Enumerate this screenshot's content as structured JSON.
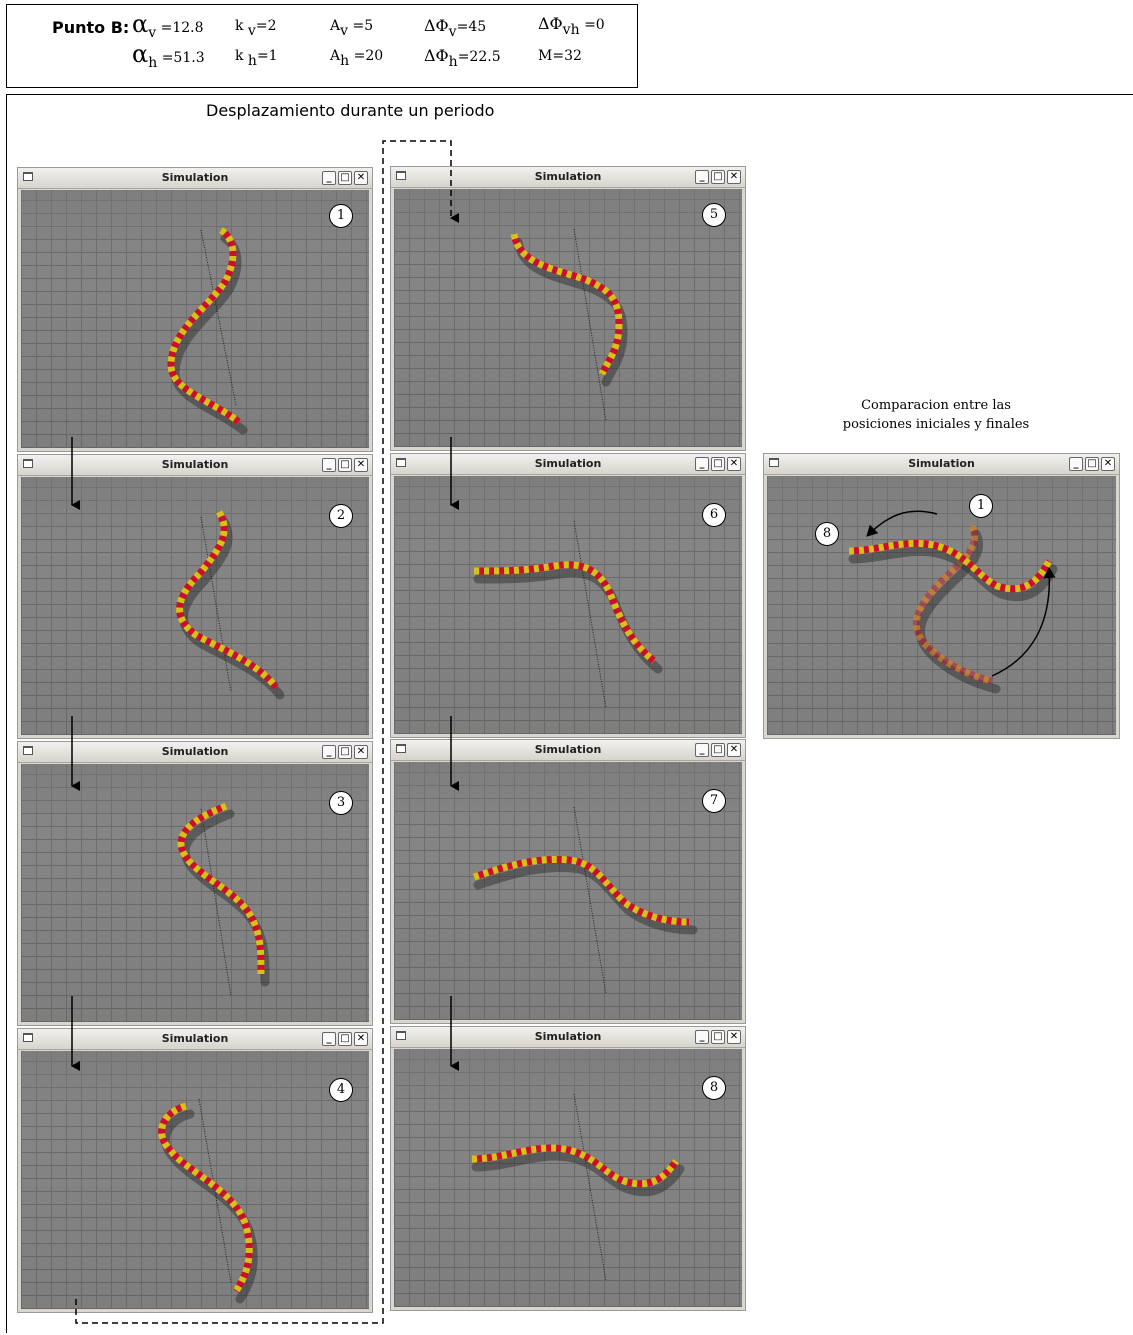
{
  "params": {
    "title": "Punto B:",
    "alpha_v": "=12.8",
    "alpha_h": "=51.3",
    "k_v": "=2",
    "k_h": "=1",
    "A_v": "=5",
    "A_h": "=20",
    "dphi_v": "=45",
    "dphi_h": "=22.5",
    "dphi_vh": "=0",
    "M": "M=32"
  },
  "period_title": "Desplazamiento durante un periodo",
  "window_title": "Simulation",
  "frames": [
    {
      "num": "1"
    },
    {
      "num": "2"
    },
    {
      "num": "3"
    },
    {
      "num": "4"
    },
    {
      "num": "5"
    },
    {
      "num": "6"
    },
    {
      "num": "7"
    },
    {
      "num": "8"
    }
  ],
  "comparison": {
    "caption_line1": "Comparacion entre las",
    "caption_line2": "posiciones iniciales y finales",
    "start_label": "1",
    "end_label": "8"
  },
  "colors": {
    "snake_red": "#c8102e",
    "snake_yellow": "#d4c21a",
    "floor": "#858585"
  }
}
